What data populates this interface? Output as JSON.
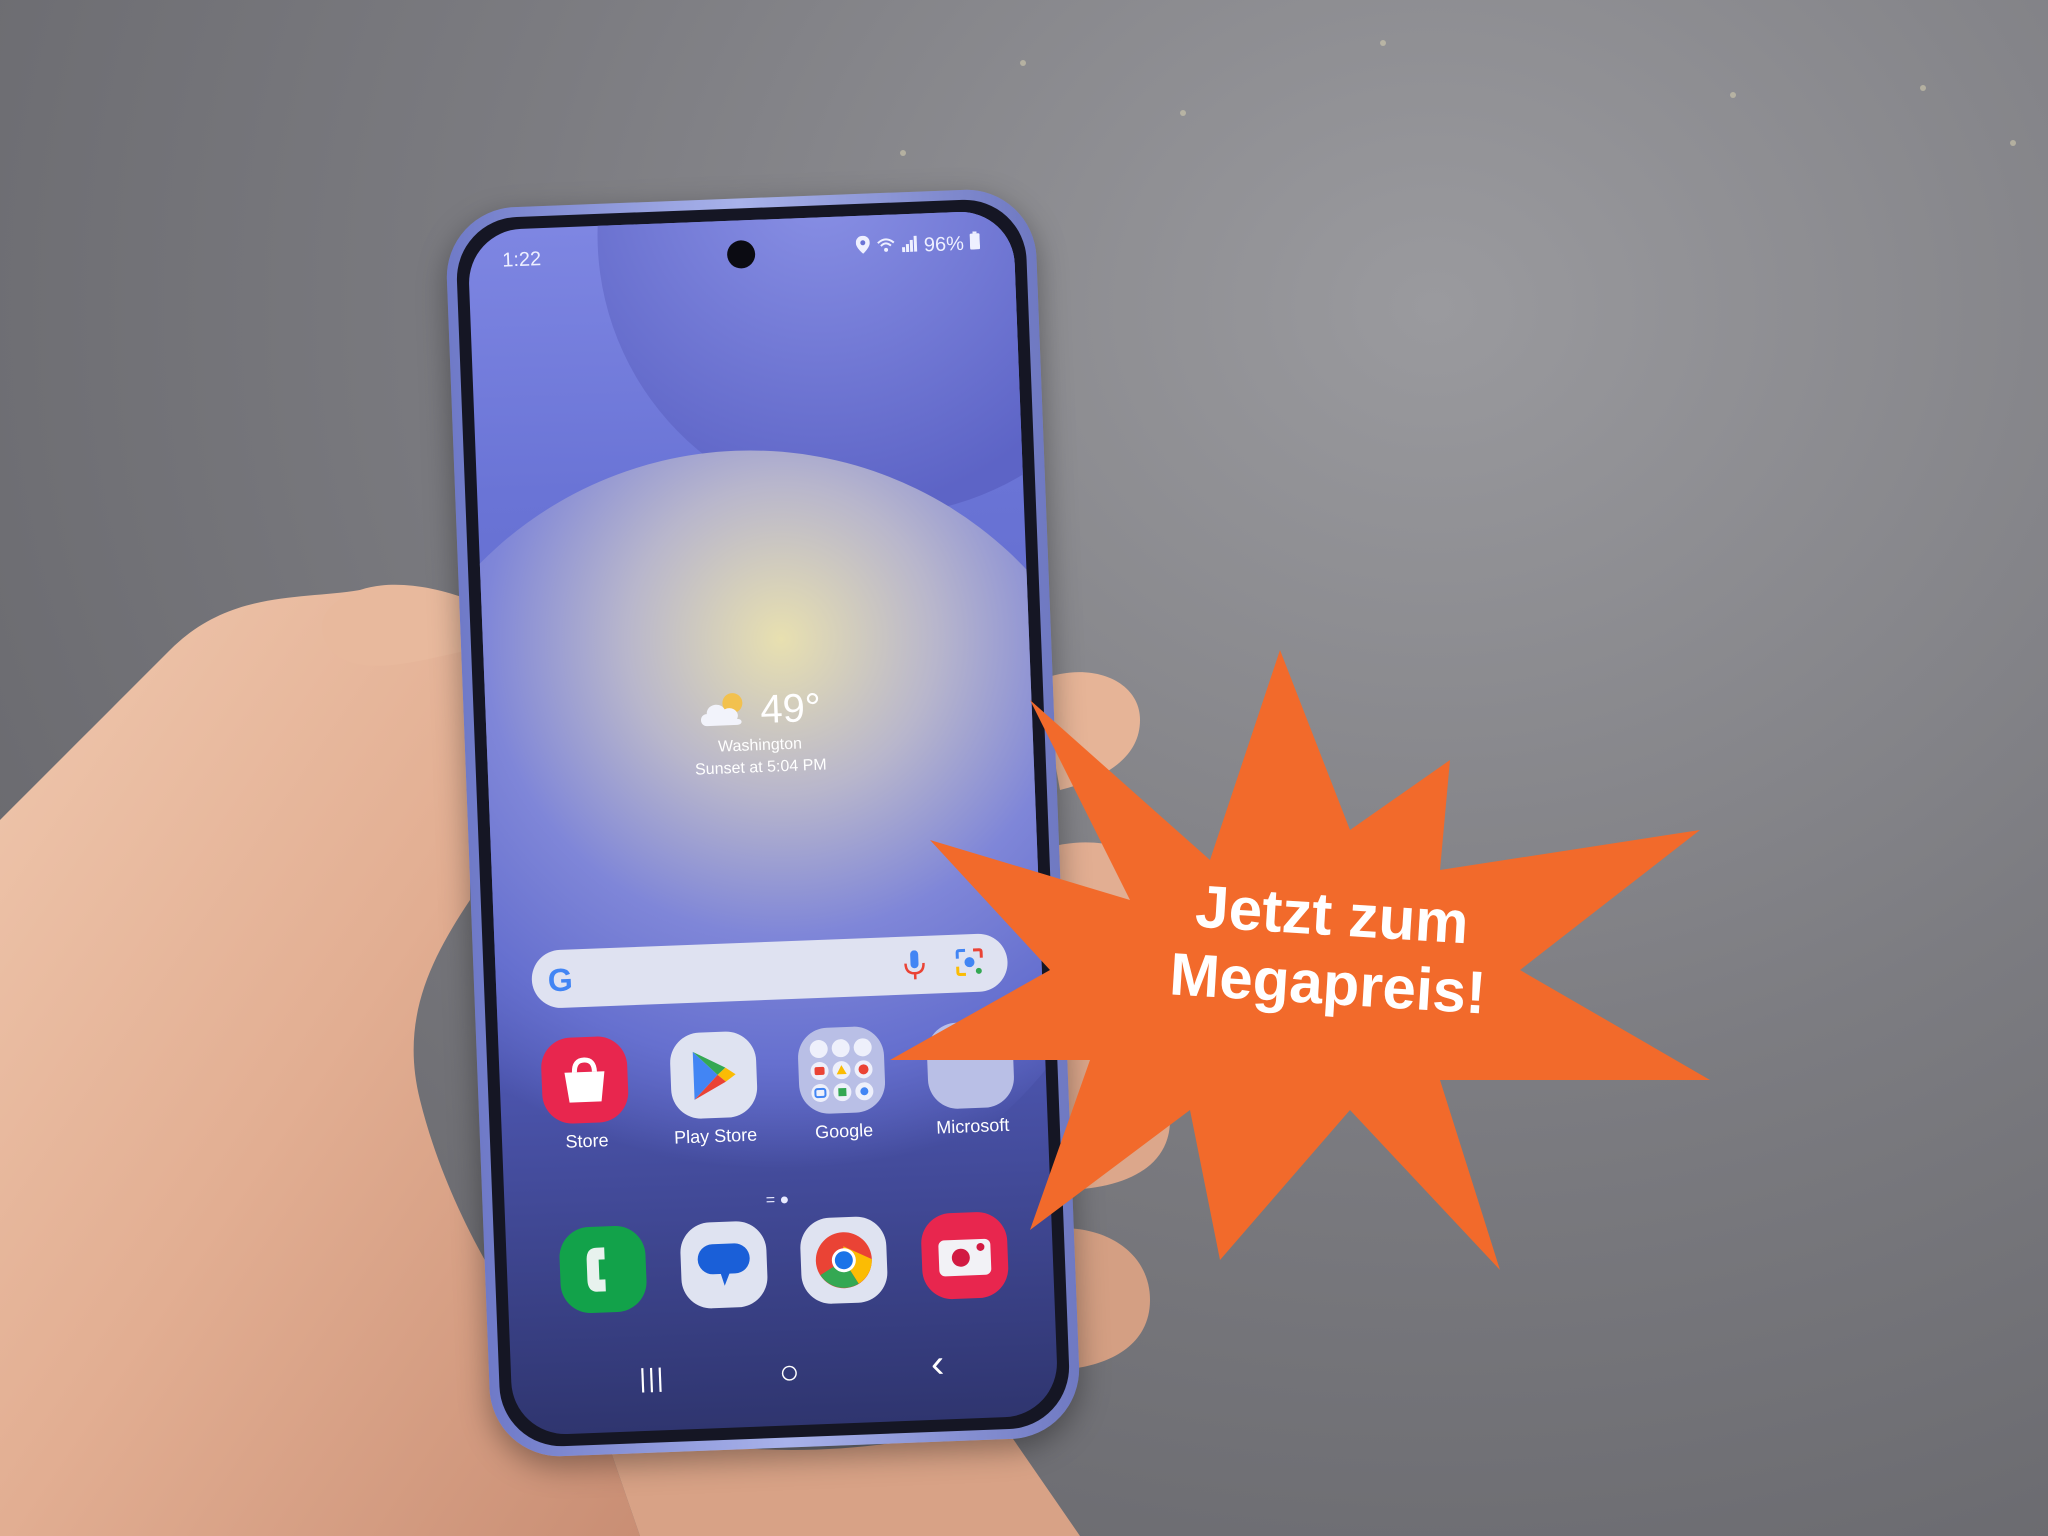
{
  "scene": {
    "description": "Hand holding a Samsung Galaxy smartphone showing its home screen, with an orange promotional starburst badge",
    "badge": {
      "line1": "Jetzt zum",
      "line2": "Megapreis!",
      "color": "#f26a2b"
    }
  },
  "phone": {
    "status_bar": {
      "time": "1:22",
      "battery": "96%",
      "icons": [
        "location-icon",
        "wifi-icon",
        "signal-icon",
        "battery-icon"
      ]
    },
    "weather_widget": {
      "temperature": "49°",
      "location": "Washington",
      "sunset": "Sunset at 5:04 PM",
      "icon": "partly-cloudy-icon"
    },
    "search_bar": {
      "logo": "G",
      "icons": [
        "microphone-icon",
        "google-lens-icon"
      ]
    },
    "apps": [
      {
        "label": "Store",
        "icon": "galaxy-store-icon",
        "color": "#e8264e"
      },
      {
        "label": "Play Store",
        "icon": "play-store-icon",
        "color": "#dfe3f1"
      },
      {
        "label": "Google",
        "icon": "google-folder-icon",
        "color": "#b9bfe6"
      },
      {
        "label": "Microsoft",
        "icon": "microsoft-folder-icon",
        "color": "#b9bfe6"
      }
    ],
    "page_indicator": "= ●",
    "dock": [
      {
        "name": "phone",
        "icon": "phone-icon",
        "color": "#12a24a"
      },
      {
        "name": "messages",
        "icon": "messages-icon",
        "color": "#dfe3f1"
      },
      {
        "name": "chrome",
        "icon": "chrome-icon",
        "color": "#dfe3f1"
      },
      {
        "name": "camera",
        "icon": "camera-icon",
        "color": "#e8264e"
      }
    ],
    "nav_bar": {
      "recents": "|||",
      "home": "○",
      "back": "‹"
    }
  }
}
